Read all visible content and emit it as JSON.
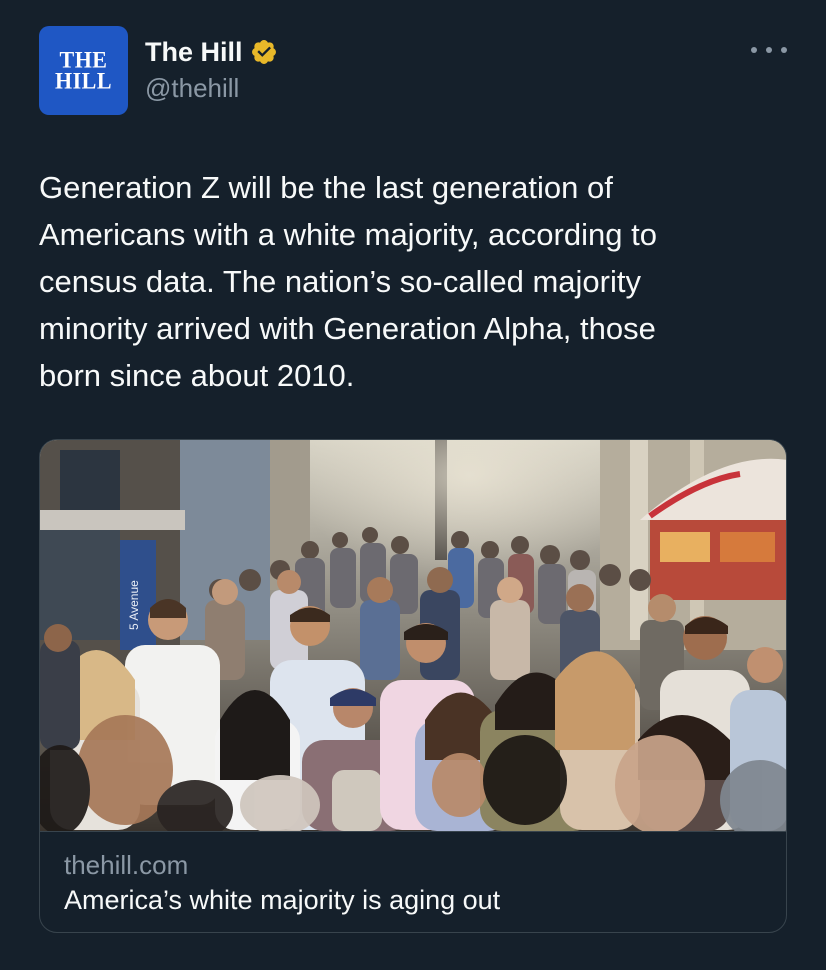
{
  "account": {
    "avatar_lines": [
      "THE",
      "HILL"
    ],
    "display_name": "The Hill",
    "handle": "@thehill",
    "verified_badge_icon": "verified-badge-icon"
  },
  "menu_icon": "more-options-icon",
  "tweet": {
    "text_lines": [
      "Generation Z will be the last generation of",
      "Americans with a white majority, according to",
      "census data. The nation’s so-called majority",
      "minority arrived with Generation Alpha, those",
      "born since about 2010."
    ]
  },
  "card": {
    "image": "photo of a crowded city street with pedestrians",
    "street_sign": "5 Avenue",
    "domain": "thehill.com",
    "title": "America’s white majority is aging out"
  },
  "colors": {
    "background": "#15202b",
    "text_primary": "#f7f9f9",
    "text_secondary": "#8b98a5",
    "border": "#38444d",
    "brand_blue": "#1f57c4",
    "verified_gold": "#e8b829"
  }
}
